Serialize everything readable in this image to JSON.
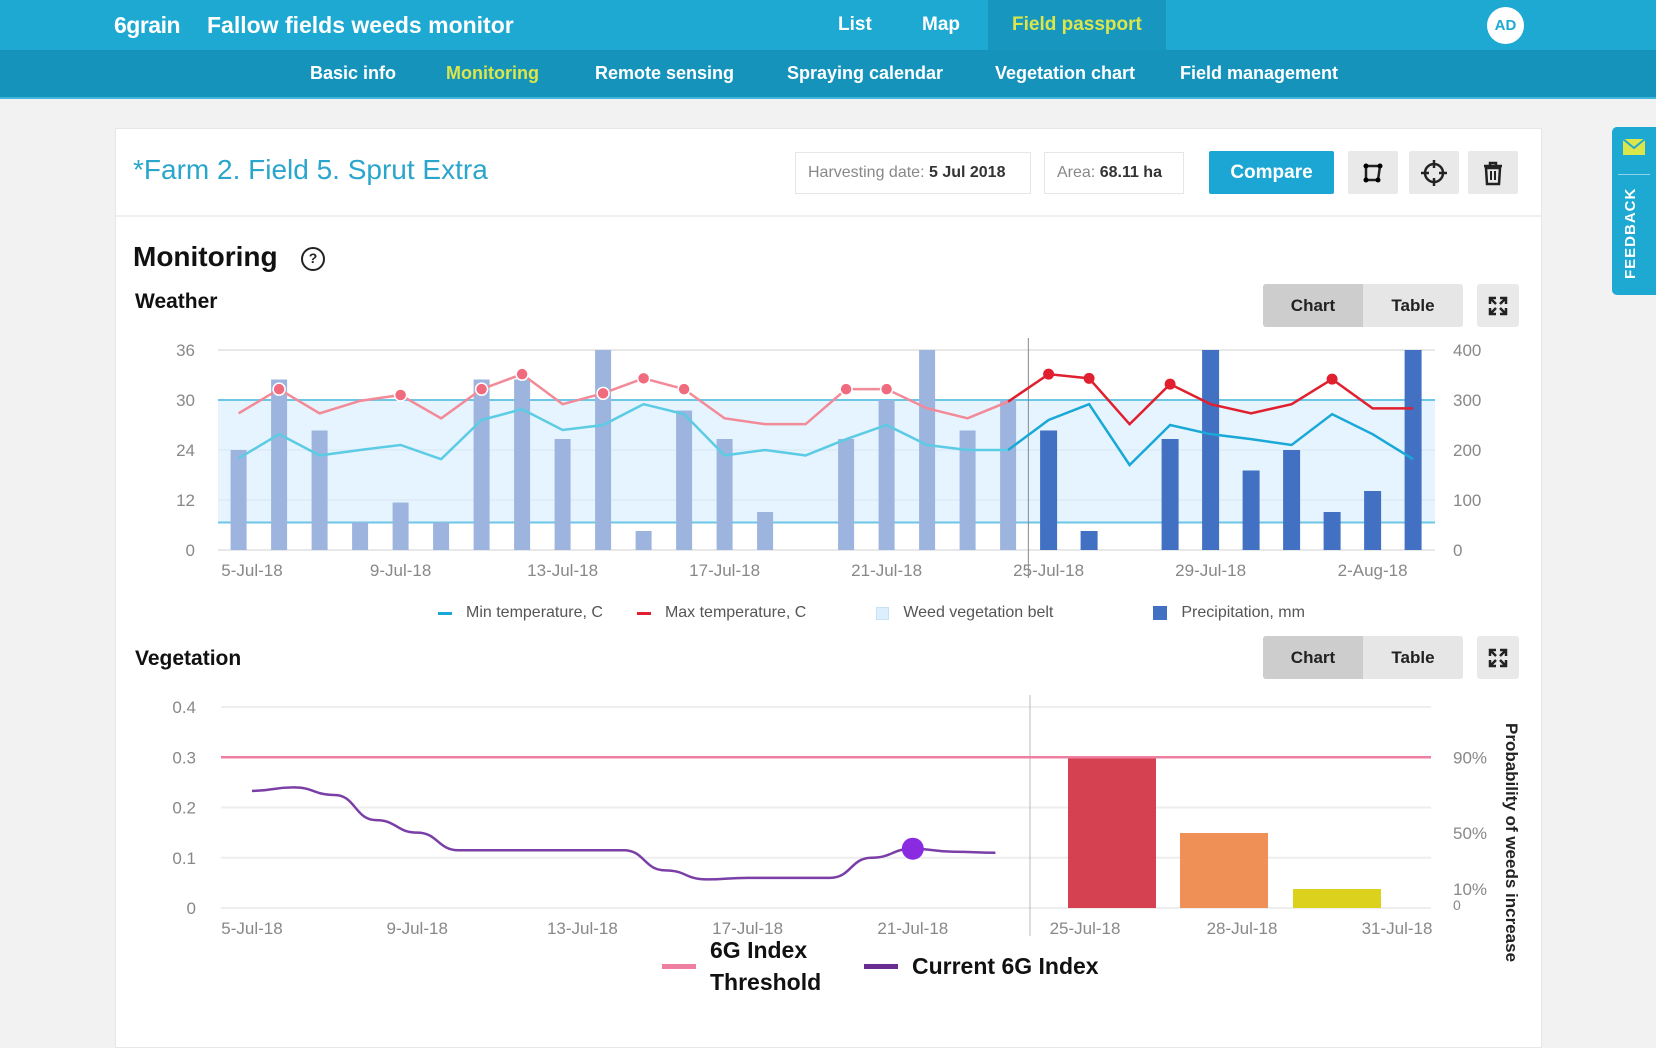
{
  "header": {
    "logo": "6grain",
    "title": "Fallow fields weeds monitor",
    "nav": [
      {
        "label": "List"
      },
      {
        "label": "Map"
      },
      {
        "label": "Field passport",
        "active": true
      }
    ],
    "avatar": "AD"
  },
  "subnav": [
    {
      "label": "Basic info"
    },
    {
      "label": "Monitoring",
      "active": true
    },
    {
      "label": "Remote sensing"
    },
    {
      "label": "Spraying calendar"
    },
    {
      "label": "Vegetation chart"
    },
    {
      "label": "Field management"
    }
  ],
  "field": {
    "title": "*Farm 2. Field 5. Sprut Extra",
    "harvest_label": "Harvesting date:",
    "harvest_value": "5 Jul 2018",
    "area_label": "Area:",
    "area_value": "68.11 ha",
    "compare": "Compare",
    "icons": [
      "polygon-edit-icon",
      "crosshair-icon",
      "trash-icon"
    ]
  },
  "feedback": "FEEDBACK",
  "monitoring": {
    "title": "Monitoring",
    "weather_title": "Weather",
    "vegetation_title": "Vegetation",
    "toggle": {
      "chart": "Chart",
      "table": "Table",
      "selected": "Chart"
    }
  },
  "colors": {
    "brand": "#1ea9d3",
    "active_nav": "#dbe64a",
    "min_hist": "#5ccbe4",
    "min_fc": "#1aa8d6",
    "max_hist": "#f28a98",
    "max_fc": "#e0202f",
    "precip_hist": "#9db4de",
    "precip_fc": "#4270c2",
    "belt": "#dcefff",
    "threshold": "#ef7fa0",
    "index": "#7a3fa6",
    "marker": "#8a2be2"
  },
  "chart_data": [
    {
      "type": "bar+line",
      "title": "Weather",
      "dates": [
        "5-Jul-18",
        "6-Jul-18",
        "7-Jul-18",
        "8-Jul-18",
        "9-Jul-18",
        "10-Jul-18",
        "11-Jul-18",
        "12-Jul-18",
        "13-Jul-18",
        "14-Jul-18",
        "15-Jul-18",
        "16-Jul-18",
        "17-Jul-18",
        "18-Jul-18",
        "19-Jul-18",
        "20-Jul-18",
        "21-Jul-18",
        "22-Jul-18",
        "23-Jul-18",
        "24-Jul-18",
        "25-Jul-18",
        "26-Jul-18",
        "27-Jul-18",
        "28-Jul-18",
        "29-Jul-18",
        "30-Jul-18",
        "31-Jul-18",
        "1-Aug-18",
        "2-Aug-18",
        "3-Aug-18"
      ],
      "x_tick_labels": [
        "5-Jul-18",
        "9-Jul-18",
        "13-Jul-18",
        "17-Jul-18",
        "21-Jul-18",
        "25-Jul-18",
        "29-Jul-18",
        "2-Aug-18"
      ],
      "forecast_from": "25-Jul-18",
      "y_left_ticks": [
        0,
        12,
        24,
        30,
        36
      ],
      "y_right_ticks": [
        0,
        100,
        200,
        300,
        400
      ],
      "y_right_range": [
        0,
        400
      ],
      "series": [
        {
          "name": "Min temperature, C",
          "axis": "left",
          "type": "line",
          "values": [
            22,
            25.9,
            22.7,
            24,
            24.6,
            21.8,
            27.6,
            28.9,
            26.4,
            27,
            29.5,
            28.3,
            22.7,
            24,
            22.7,
            25.3,
            27,
            24.6,
            24,
            24,
            27.6,
            29.5,
            20.4,
            27,
            25.9,
            25.3,
            24.6,
            28.3,
            25.9,
            21.8
          ]
        },
        {
          "name": "Max temperature, C",
          "axis": "left",
          "type": "line",
          "values": [
            28.4,
            31.3,
            28.4,
            29.9,
            30.6,
            27.8,
            31.3,
            33.1,
            29.5,
            30.8,
            32.6,
            31.3,
            27.8,
            27.1,
            27.1,
            31.3,
            31.3,
            29,
            27.8,
            29.8,
            33.1,
            32.6,
            27.1,
            31.9,
            29.5,
            28.4,
            29.5,
            32.5,
            29,
            29
          ]
        },
        {
          "name": "Weed vegetation belt",
          "axis": "left",
          "type": "band",
          "range": [
            6.6,
            30
          ]
        },
        {
          "name": "Precipitation, mm",
          "axis": "right",
          "type": "bar",
          "values": [
            200,
            341,
            239,
            55,
            95,
            55,
            341,
            341,
            222,
            400,
            38,
            279,
            222,
            76,
            0,
            222,
            300,
            400,
            239,
            300,
            239,
            38,
            0,
            222,
            400,
            159,
            200,
            76,
            118,
            400
          ]
        }
      ],
      "grid": true,
      "legend": "bottom"
    },
    {
      "type": "line+bar",
      "title": "Vegetation",
      "x_tick_labels": [
        "5-Jul-18",
        "9-Jul-18",
        "13-Jul-18",
        "17-Jul-18",
        "21-Jul-18"
      ],
      "y_left_ticks": [
        0,
        0.1,
        0.2,
        0.3,
        0.4
      ],
      "y_left_range": [
        0,
        0.4
      ],
      "y_right_label": "Probability of weeds increase",
      "y_right_ticks": [
        "0",
        "10%",
        "50%",
        "90%"
      ],
      "threshold": {
        "name": "6G Index Threshold",
        "value": 0.3
      },
      "index": {
        "name": "Current 6G Index",
        "dates": [
          "5-Jul-18",
          "6-Jul-18",
          "7-Jul-18",
          "8-Jul-18",
          "9-Jul-18",
          "10-Jul-18",
          "11-Jul-18",
          "12-Jul-18",
          "13-Jul-18",
          "14-Jul-18",
          "15-Jul-18",
          "16-Jul-18",
          "17-Jul-18",
          "18-Jul-18",
          "19-Jul-18",
          "20-Jul-18",
          "21-Jul-18",
          "22-Jul-18",
          "23-Jul-18"
        ],
        "values": [
          0.233,
          0.24,
          0.225,
          0.175,
          0.15,
          0.115,
          0.115,
          0.115,
          0.115,
          0.115,
          0.075,
          0.057,
          0.06,
          0.06,
          0.06,
          0.1,
          0.118,
          0.112,
          0.11
        ],
        "highlight": "21-Jul-18"
      },
      "probability": {
        "categories": [
          "25-Jul-18",
          "28-Jul-18",
          "31-Jul-18"
        ],
        "values": [
          90,
          50,
          10
        ],
        "colors": [
          "#d64152",
          "#ef9156",
          "#dcd21e"
        ]
      },
      "grid": true,
      "legend": "bottom"
    }
  ]
}
